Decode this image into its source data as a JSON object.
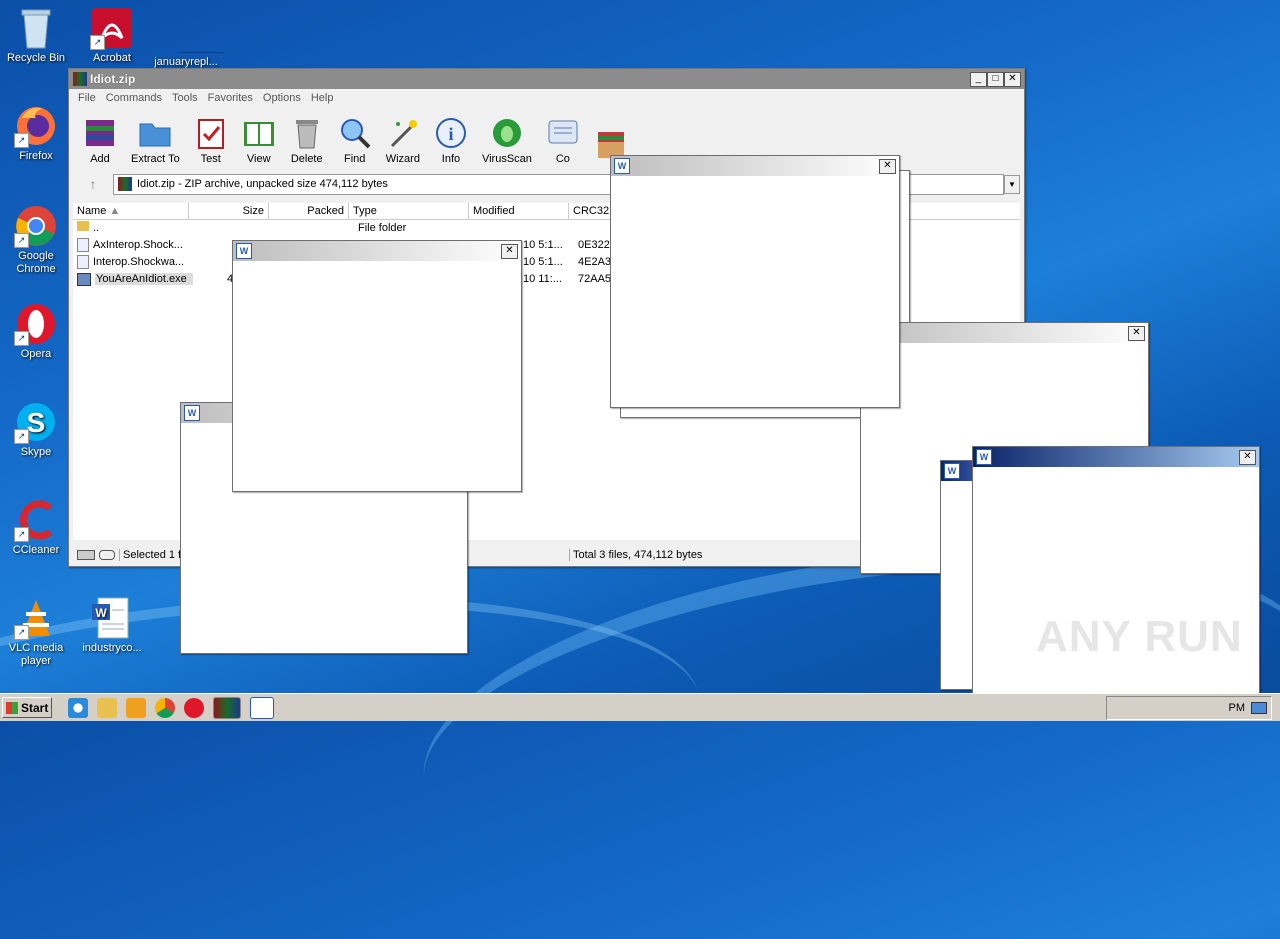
{
  "desktop": {
    "icons": [
      {
        "label": "Recycle Bin"
      },
      {
        "label": "Acrobat"
      },
      {
        "label": "januaryrepl..."
      },
      {
        "label": "Firefox"
      },
      {
        "label": "Google Chrome"
      },
      {
        "label": "Opera"
      },
      {
        "label": "Skype"
      },
      {
        "label": "CCleaner"
      },
      {
        "label": "VLC media player"
      },
      {
        "label": "industryco..."
      }
    ]
  },
  "winrar": {
    "title": "Idiot.zip",
    "menu": [
      "File",
      "Commands",
      "Tools",
      "Favorites",
      "Options",
      "Help"
    ],
    "toolbar": [
      "Add",
      "Extract To",
      "Test",
      "View",
      "Delete",
      "Find",
      "Wizard",
      "Info",
      "VirusScan",
      "Co"
    ],
    "address": "Idiot.zip - ZIP archive, unpacked size 474,112 bytes",
    "columns": [
      "Name",
      "Size",
      "Packed",
      "Type",
      "Modified",
      "CRC32"
    ],
    "rows": [
      {
        "name": "..",
        "type": "File folder",
        "modified": "",
        "crc": ""
      },
      {
        "name": "AxInterop.Shock...",
        "type": "",
        "modified": "10 5:1...",
        "crc": "0E322"
      },
      {
        "name": "Interop.Shockwa...",
        "type": "",
        "modified": "10 5:1...",
        "crc": "4E2A3"
      },
      {
        "name": "YouAreAnIdiot.exe",
        "type": "",
        "modified": "10 11:...",
        "crc": "72AA5"
      }
    ],
    "size_partial": "4",
    "status_left": "Selected 1 file",
    "status_right": "Total 3 files, 474,112 bytes"
  },
  "taskbar": {
    "start_label": "Start",
    "clock": "PM"
  },
  "watermark": "ANY RUN"
}
